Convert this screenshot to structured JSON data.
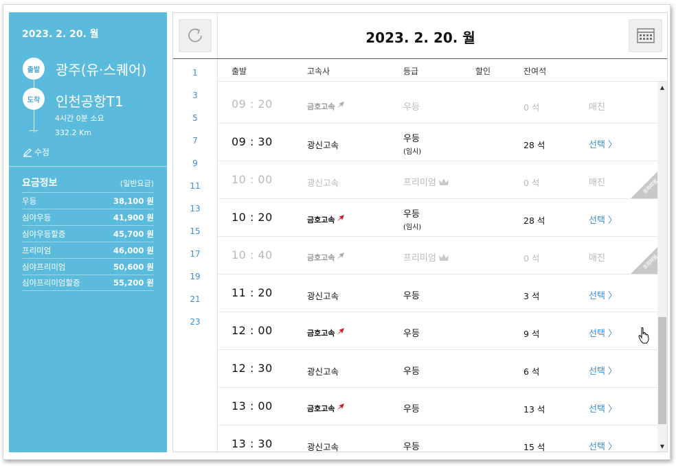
{
  "summary": {
    "date": "2023. 2. 20. 월",
    "departure_badge": "출발",
    "departure": "광주(유·스퀘어)",
    "arrival_badge": "도착",
    "arrival": "인천공항T1",
    "duration": "4시간 0분 소요",
    "distance": "332.2 Km",
    "edit_label": "수정"
  },
  "fares": {
    "title": "요금정보",
    "subtitle": "(일반요금)",
    "items": [
      {
        "name": "우등",
        "price": "38,100 원"
      },
      {
        "name": "심야우등",
        "price": "41,900 원"
      },
      {
        "name": "심야우등할증",
        "price": "45,700 원"
      },
      {
        "name": "프리미엄",
        "price": "46,000 원"
      },
      {
        "name": "심야프리미엄",
        "price": "50,600 원"
      },
      {
        "name": "심야프리미엄할증",
        "price": "55,200 원"
      }
    ]
  },
  "header": {
    "date": "2023. 2. 20. 월"
  },
  "hours": [
    "1",
    "3",
    "5",
    "7",
    "9",
    "11",
    "13",
    "15",
    "17",
    "19",
    "21",
    "23"
  ],
  "columns": {
    "depart": "출발",
    "company": "고속사",
    "grade": "등급",
    "discount": "할인",
    "seats": "잔여석"
  },
  "rows": [
    {
      "time": "09 : 20",
      "company": "금호고속",
      "grade": "우등",
      "sub": "",
      "seats": "0 석",
      "action": "매진"
    },
    {
      "time": "09 : 30",
      "company": "광신고속",
      "grade": "우등",
      "sub": "(임시)",
      "seats": "28 석",
      "action": "선택 〉"
    },
    {
      "time": "10 : 00",
      "company": "광신고속",
      "grade": "프리미엄",
      "sub": "",
      "seats": "0 석",
      "action": "매진"
    },
    {
      "time": "10 : 20",
      "company": "금호고속",
      "grade": "우등",
      "sub": "(임시)",
      "seats": "28 석",
      "action": "선택 〉"
    },
    {
      "time": "10 : 40",
      "company": "금호고속",
      "grade": "프리미엄",
      "sub": "",
      "seats": "0 석",
      "action": "매진"
    },
    {
      "time": "11 : 20",
      "company": "광신고속",
      "grade": "우등",
      "sub": "",
      "seats": "3 석",
      "action": "선택 〉"
    },
    {
      "time": "12 : 00",
      "company": "금호고속",
      "grade": "우등",
      "sub": "",
      "seats": "9 석",
      "action": "선택 〉"
    },
    {
      "time": "12 : 30",
      "company": "광신고속",
      "grade": "우등",
      "sub": "",
      "seats": "6 석",
      "action": "선택 〉"
    },
    {
      "time": "13 : 00",
      "company": "금호고속",
      "grade": "우등",
      "sub": "",
      "seats": "13 석",
      "action": "선택 〉"
    },
    {
      "time": "13 : 30",
      "company": "광신고속",
      "grade": "우등",
      "sub": "",
      "seats": "15 석",
      "action": "선택 〉"
    }
  ],
  "ribbon_label": "프리미엄",
  "colors": {
    "panel": "#5bbbdc",
    "link": "#3a8fd6",
    "sold": "#b9b9b9",
    "kumho_red": "#d0182c"
  }
}
